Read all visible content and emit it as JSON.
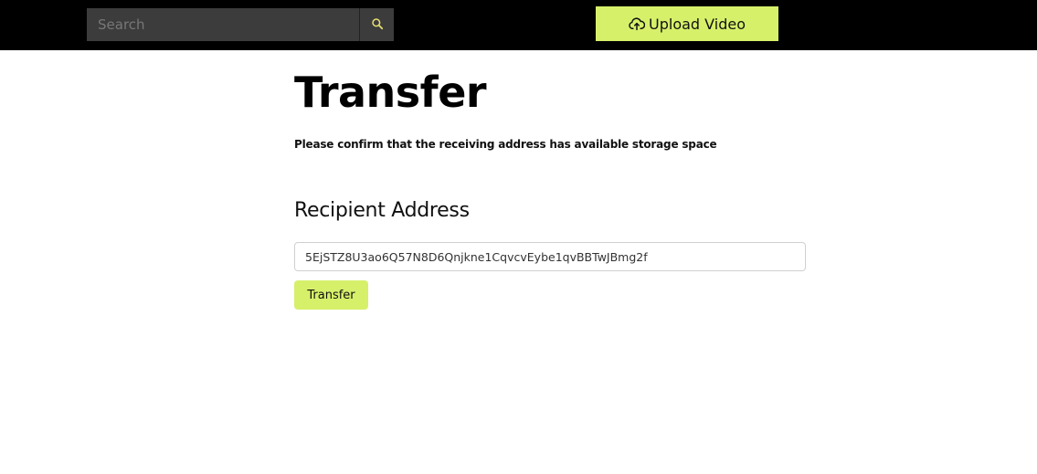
{
  "header": {
    "search": {
      "placeholder": "Search",
      "value": ""
    },
    "search_icon": "search-icon",
    "upload_label": "Upload Video",
    "upload_icon": "cloud-upload-icon"
  },
  "main": {
    "title": "Transfer",
    "subtitle": "Please confirm that the receiving address has available storage space",
    "recipient_heading": "Recipient Address",
    "recipient_value": "5EjSTZ8U3ao6Q57N8D6Qnjkne1CqvcvEybe1qvBBTwJBmg2f",
    "transfer_label": "Transfer"
  },
  "colors": {
    "header_bg": "#000000",
    "accent": "#d6f06a",
    "search_bg": "#3c3c3c"
  }
}
